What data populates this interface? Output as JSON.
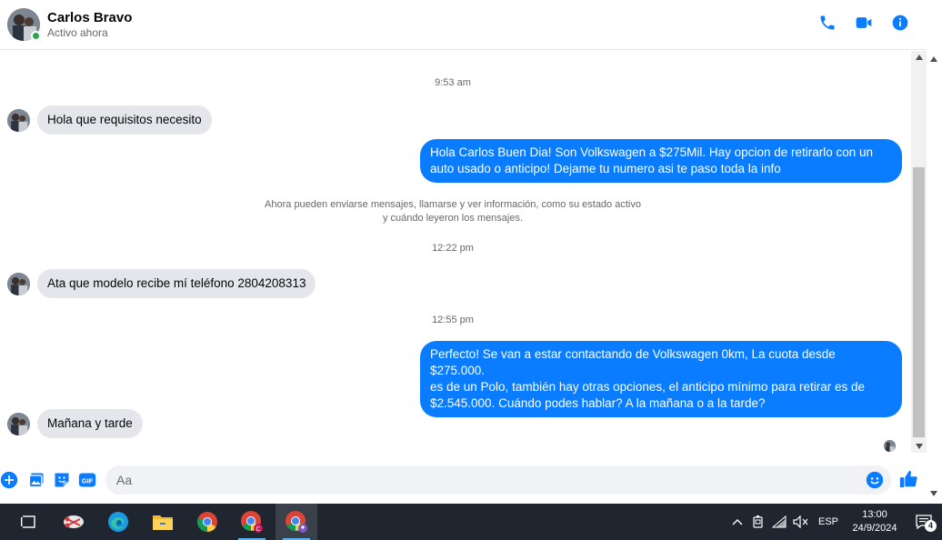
{
  "header": {
    "contact_name": "Carlos Bravo",
    "status": "Activo ahora",
    "icons": [
      "phone-icon",
      "video-icon",
      "info-icon"
    ]
  },
  "messages": {
    "time_1": "9:53 am",
    "msg_1": "Hola que requisitos necesito",
    "reply_1_line1": "Hola Carlos Buen Dia! Son Volkswagen a $275Mil. Hay opcion de retirarlo con un",
    "reply_1_line2": "auto usado o anticipo! Dejame tu numero asi te paso toda la info",
    "notice_line1": "Ahora pueden enviarse mensajes, llamarse y ver información, como su estado activo",
    "notice_line2": "y cuándo leyeron los mensajes.",
    "time_2": "12:22 pm",
    "msg_2": "Ata que modelo recibe mí teléfono 2804208313",
    "time_3": "12:55 pm",
    "reply_2_line1": "Perfecto!  Se van a estar contactando de Volkswagen 0km, La cuota desde $275.000.",
    "reply_2_line2": "es de un Polo, también hay otras opciones, el anticipo mínimo para retirar es de",
    "reply_2_line3": "$2.545.000. Cuándo podes hablar? A la mañana o a la tarde?",
    "msg_3": "Mañana y tarde"
  },
  "composer": {
    "placeholder": "Aa",
    "gif_label": "GIF"
  },
  "taskbar": {
    "language": "ESP",
    "time": "13:00",
    "date": "24/9/2024",
    "notification_count": "4"
  },
  "colors": {
    "accent": "#0a7cff",
    "incoming_bubble": "#e4e6eb",
    "online": "#31a24c",
    "taskbar_bg": "#1f2630"
  }
}
